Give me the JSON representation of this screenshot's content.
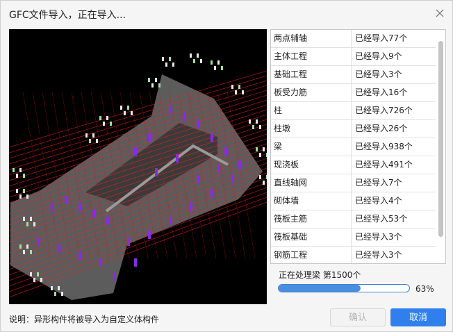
{
  "dialog": {
    "title": "GFC文件导入，正在导入...",
    "note": "说明：异形构件将被导入为自定义体构件"
  },
  "import_table": {
    "rows": [
      {
        "name": "两点辅轴",
        "status": "已经导入77个"
      },
      {
        "name": "主体工程",
        "status": "已经导入9个"
      },
      {
        "name": "基础工程",
        "status": "已经导入3个"
      },
      {
        "name": "板受力筋",
        "status": "已经导入16个"
      },
      {
        "name": "柱",
        "status": "已经导入726个"
      },
      {
        "name": "柱墩",
        "status": "已经导入26个"
      },
      {
        "name": "梁",
        "status": "已经导入938个"
      },
      {
        "name": "现浇板",
        "status": "已经导入491个"
      },
      {
        "name": "直线轴网",
        "status": "已经导入7个"
      },
      {
        "name": "砌体墙",
        "status": "已经导入4个"
      },
      {
        "name": "筏板主筋",
        "status": "已经导入53个"
      },
      {
        "name": "筏板基础",
        "status": "已经导入3个"
      },
      {
        "name": "钢筋工程",
        "status": "已经导入3个"
      }
    ]
  },
  "progress": {
    "status_text": "正在处理梁  第1500个",
    "percent_label": "63%",
    "fraction": 0.63
  },
  "buttons": {
    "confirm": "确认",
    "cancel": "取消"
  },
  "colors": {
    "accent": "#2f80ed",
    "preview_bg": "#000000",
    "beam_red": "#ff2020",
    "column_purple": "#8a2be2",
    "slab_gray": "#6e6e6e"
  },
  "icons": {
    "close": "close-icon"
  }
}
